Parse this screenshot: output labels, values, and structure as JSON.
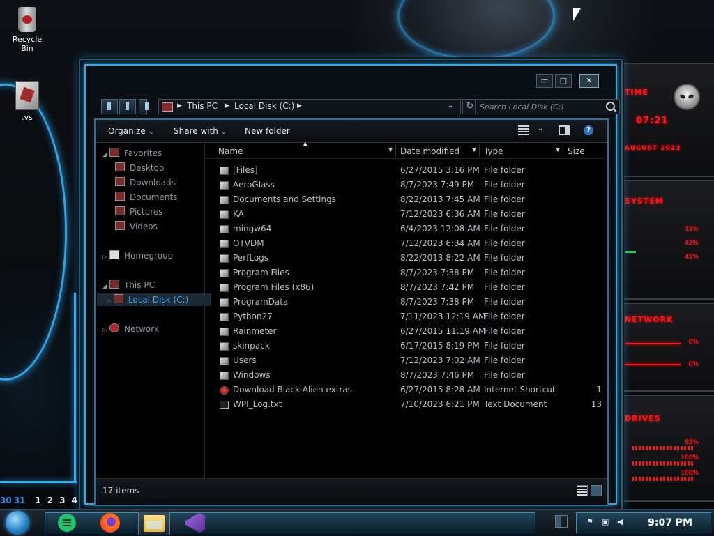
{
  "desktop": {
    "icons": [
      {
        "label": "Recycle Bin"
      },
      {
        "label": ".vs"
      }
    ],
    "calendar_days": [
      "30",
      "31",
      "1",
      "2",
      "3",
      "4"
    ]
  },
  "gadgets": {
    "time_title": "TIME",
    "time_value": "07:21",
    "date_value": "AUGUST 2023",
    "system_title": "SYSTEM",
    "cpu1": "31%",
    "cpu2": "42%",
    "ram": "41%",
    "network_title": "NETWORK",
    "net_up": "0%",
    "net_down": "0%",
    "drives_title": "DRIVES",
    "drive1": "95%",
    "drive2": "100%",
    "drive3": "100%"
  },
  "window": {
    "controls": {
      "minimize": "▭",
      "maximize": "□",
      "close": "✕"
    },
    "breadcrumb": [
      "This PC",
      "Local Disk (C:)"
    ],
    "search_placeholder": "Search Local Disk (C:)",
    "refresh": "↻",
    "toolbar": {
      "organize": "Organize",
      "share_with": "Share with",
      "new_folder": "New folder",
      "help": "?"
    },
    "nav": {
      "favorites": "Favorites",
      "desktop": "Desktop",
      "downloads": "Downloads",
      "documents": "Documents",
      "pictures": "Pictures",
      "videos": "Videos",
      "homegroup": "Homegroup",
      "this_pc": "This PC",
      "local_disk": "Local Disk (C:)",
      "network": "Network"
    },
    "columns": {
      "name": "Name",
      "date_modified": "Date modified",
      "type": "Type",
      "size": "Size"
    },
    "files": [
      {
        "name": "[Files]",
        "date": "6/27/2015 3:16 PM",
        "type": "File folder",
        "size": ""
      },
      {
        "name": "AeroGlass",
        "date": "8/7/2023 7:49 PM",
        "type": "File folder",
        "size": ""
      },
      {
        "name": "Documents and Settings",
        "date": "8/22/2013 7:45 AM",
        "type": "File folder",
        "size": ""
      },
      {
        "name": "KA",
        "date": "7/12/2023 6:36 AM",
        "type": "File folder",
        "size": ""
      },
      {
        "name": "mingw64",
        "date": "6/4/2023 12:08 AM",
        "type": "File folder",
        "size": ""
      },
      {
        "name": "OTVDM",
        "date": "7/12/2023 6:34 AM",
        "type": "File folder",
        "size": ""
      },
      {
        "name": "PerfLogs",
        "date": "8/22/2013 8:22 AM",
        "type": "File folder",
        "size": ""
      },
      {
        "name": "Program Files",
        "date": "8/7/2023 7:38 PM",
        "type": "File folder",
        "size": ""
      },
      {
        "name": "Program Files (x86)",
        "date": "8/7/2023 7:42 PM",
        "type": "File folder",
        "size": ""
      },
      {
        "name": "ProgramData",
        "date": "8/7/2023 7:38 PM",
        "type": "File folder",
        "size": ""
      },
      {
        "name": "Python27",
        "date": "7/11/2023 12:19 AM",
        "type": "File folder",
        "size": ""
      },
      {
        "name": "Rainmeter",
        "date": "6/27/2015 11:19 AM",
        "type": "File folder",
        "size": ""
      },
      {
        "name": "skinpack",
        "date": "6/17/2015 8:19 PM",
        "type": "File folder",
        "size": ""
      },
      {
        "name": "Users",
        "date": "7/12/2023 7:02 AM",
        "type": "File folder",
        "size": ""
      },
      {
        "name": "Windows",
        "date": "8/7/2023 7:46 PM",
        "type": "File folder",
        "size": ""
      },
      {
        "name": "Download Black Alien extras",
        "date": "6/27/2015 8:28 AM",
        "type": "Internet Shortcut",
        "size": "1"
      },
      {
        "name": "WPI_Log.txt",
        "date": "7/10/2023 6:21 PM",
        "type": "Text Document",
        "size": "13"
      }
    ],
    "status": "17 items"
  },
  "taskbar": {
    "clock": "9:07 PM"
  }
}
